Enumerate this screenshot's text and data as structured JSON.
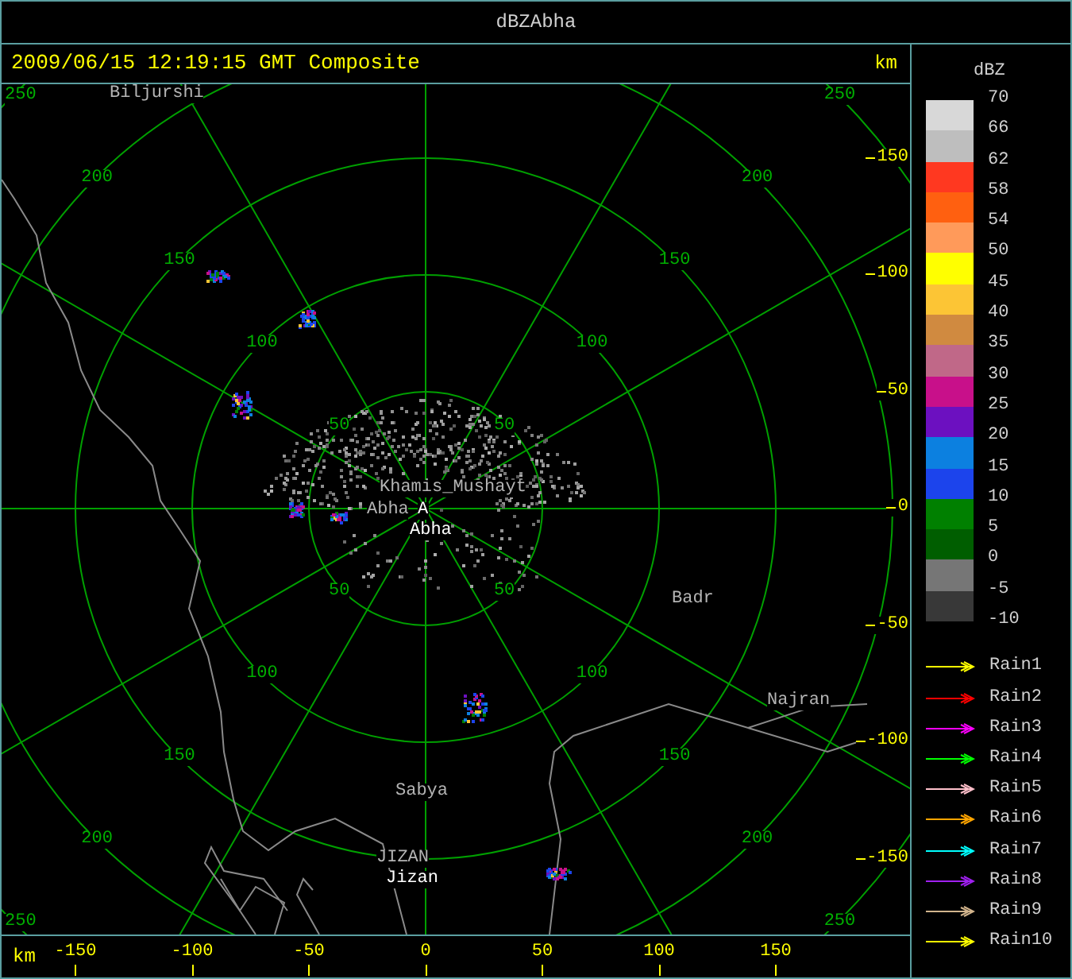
{
  "window": {
    "title": "dBZAbha"
  },
  "header": {
    "timestamp": "2009/06/15 12:19:15 GMT Composite",
    "y_unit": "km"
  },
  "map": {
    "places": [
      {
        "label": "Biljurshi",
        "kind": "town"
      },
      {
        "label": "Khamis_Mushayt",
        "kind": "town"
      },
      {
        "label": "Abha",
        "kind": "town"
      },
      {
        "label": "A",
        "kind": "station"
      },
      {
        "label": "Abha",
        "kind": "station"
      },
      {
        "label": "Badr",
        "kind": "town"
      },
      {
        "label": "Najran",
        "kind": "town"
      },
      {
        "label": "Sabya",
        "kind": "town"
      },
      {
        "label": "JIZAN",
        "kind": "town"
      },
      {
        "label": "Jizan",
        "kind": "station"
      }
    ],
    "ring_labels": [
      {
        "label": "50"
      },
      {
        "label": "50"
      },
      {
        "label": "50"
      },
      {
        "label": "50"
      },
      {
        "label": "100"
      },
      {
        "label": "100"
      },
      {
        "label": "100"
      },
      {
        "label": "100"
      },
      {
        "label": "150"
      },
      {
        "label": "150"
      },
      {
        "label": "150"
      },
      {
        "label": "150"
      },
      {
        "label": "200"
      },
      {
        "label": "200"
      },
      {
        "label": "200"
      },
      {
        "label": "200"
      },
      {
        "label": "250"
      },
      {
        "label": "250"
      },
      {
        "label": "250"
      },
      {
        "label": "250"
      }
    ],
    "y_ticks": [
      "150",
      "100",
      "50",
      "0",
      "-50",
      "-100",
      "-150"
    ],
    "x_ticks": [
      "-150",
      "-100",
      "-50",
      "0",
      "50",
      "100",
      "150"
    ],
    "x_unit": "km"
  },
  "legend": {
    "title": "dBZ",
    "bands": [
      {
        "color": "#d8d8d8"
      },
      {
        "color": "#bebebe"
      },
      {
        "color": "#ff3820"
      },
      {
        "color": "#ff6010"
      },
      {
        "color": "#ff9a5a"
      },
      {
        "color": "#ffff00"
      },
      {
        "color": "#fcc535"
      },
      {
        "color": "#d08a40"
      },
      {
        "color": "#c06888"
      },
      {
        "color": "#c8108a"
      },
      {
        "color": "#6c10c0"
      },
      {
        "color": "#0c80e0"
      },
      {
        "color": "#1c44ec"
      },
      {
        "color": "#008000"
      },
      {
        "color": "#005e00"
      },
      {
        "color": "#767676"
      },
      {
        "color": "#383838"
      }
    ],
    "labels": [
      "70",
      "66",
      "62",
      "58",
      "54",
      "50",
      "45",
      "40",
      "35",
      "30",
      "25",
      "20",
      "15",
      "10",
      "5",
      "0",
      "-5",
      "-10"
    ],
    "tracks": [
      {
        "label": "Rain1",
        "color": "#ffff00"
      },
      {
        "label": "Rain2",
        "color": "#ff0000"
      },
      {
        "label": "Rain3",
        "color": "#ff00ff"
      },
      {
        "label": "Rain4",
        "color": "#00ff00"
      },
      {
        "label": "Rain5",
        "color": "#ffc0cb"
      },
      {
        "label": "Rain6",
        "color": "#ffa500"
      },
      {
        "label": "Rain7",
        "color": "#00ffff"
      },
      {
        "label": "Rain8",
        "color": "#a020f0"
      },
      {
        "label": "Rain9",
        "color": "#d2b48c"
      },
      {
        "label": "Rain10",
        "color": "#ffff00"
      }
    ]
  }
}
